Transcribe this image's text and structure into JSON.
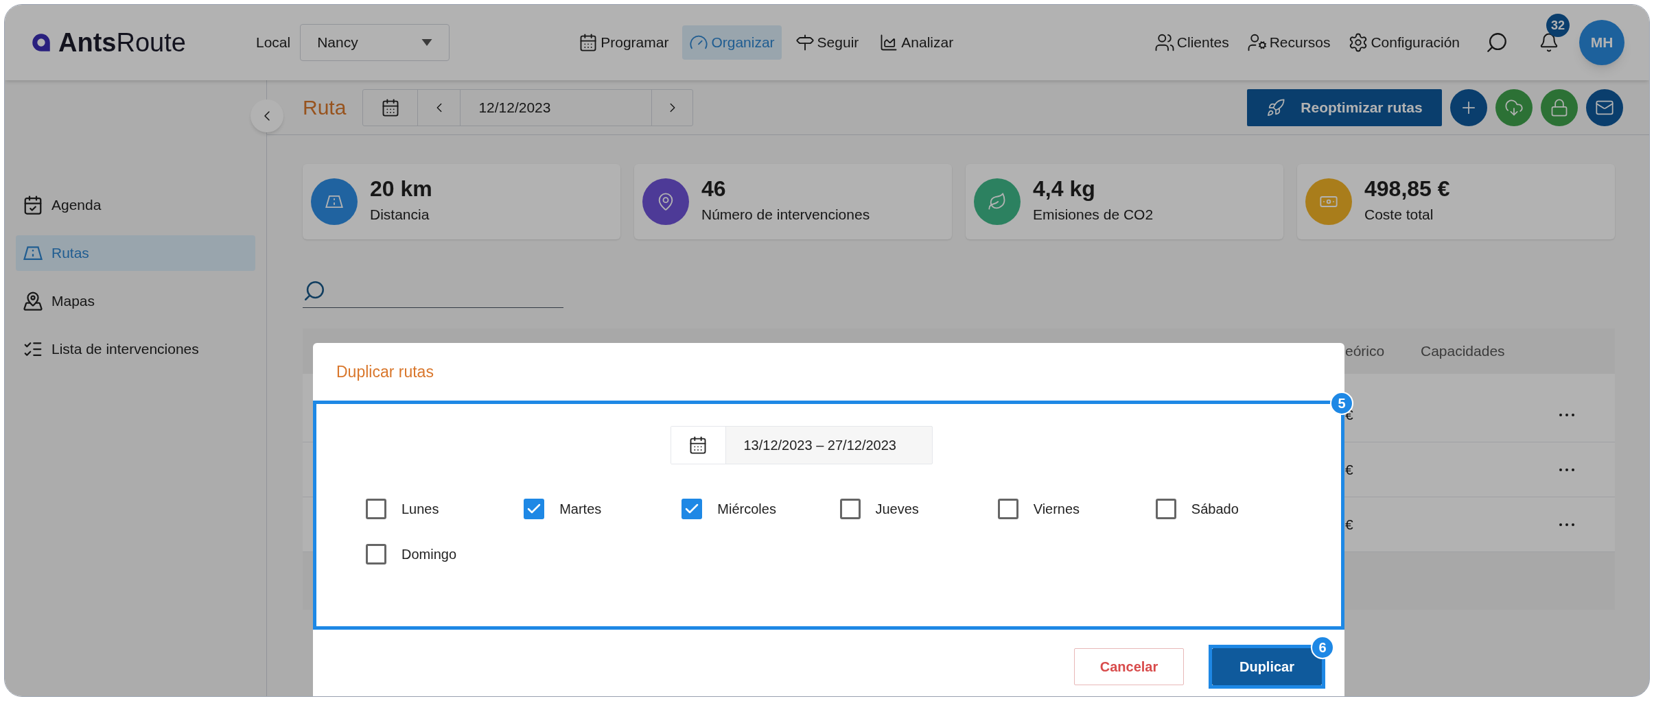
{
  "header": {
    "logo": {
      "brand_bold": "Ants",
      "brand_light": "Route"
    },
    "location": {
      "label": "Local",
      "value": "Nancy"
    },
    "nav": [
      {
        "label": "Programar",
        "selected": false,
        "kind": "calendar"
      },
      {
        "label": "Organizar",
        "selected": true,
        "kind": "gauge"
      },
      {
        "label": "Seguir",
        "selected": false,
        "kind": "signpost"
      },
      {
        "label": "Analizar",
        "selected": false,
        "kind": "chart"
      }
    ],
    "tools": [
      {
        "label": "Clientes",
        "kind": "clients"
      },
      {
        "label": "Recursos",
        "kind": "resources"
      },
      {
        "label": "Configuración",
        "kind": "settings"
      }
    ],
    "notifications": {
      "count": "32"
    },
    "avatar": {
      "initials": "MH"
    }
  },
  "sidebar": {
    "items": [
      {
        "label": "Agenda",
        "selected": false,
        "kind": "agenda"
      },
      {
        "label": "Rutas",
        "selected": true,
        "kind": "routes"
      },
      {
        "label": "Mapas",
        "selected": false,
        "kind": "maps"
      },
      {
        "label": "Lista de intervenciones",
        "selected": false,
        "kind": "list"
      }
    ]
  },
  "toolbar": {
    "title": "Ruta",
    "date": "12/12/2023",
    "primary_action": "Reoptimizar rutas",
    "actions": [
      {
        "kind": "add"
      },
      {
        "kind": "download"
      },
      {
        "kind": "lock"
      },
      {
        "kind": "mail"
      }
    ]
  },
  "stats": [
    {
      "value": "20 km",
      "label": "Distancia",
      "kind": "distance"
    },
    {
      "value": "46",
      "label": "Número de intervenciones",
      "kind": "interventions"
    },
    {
      "value": "4,4 kg",
      "label": "Emisiones de CO2",
      "kind": "emissions"
    },
    {
      "value": "498,85 €",
      "label": "Coste total",
      "kind": "cost"
    }
  ],
  "table": {
    "columns": [
      "eórico",
      "Capacidades"
    ],
    "rows": [
      {
        "cell": "€"
      },
      {
        "cell": "€"
      },
      {
        "cell": "€"
      }
    ]
  },
  "dialog": {
    "title": "Duplicar rutas",
    "date_range": "13/12/2023 – 27/12/2023",
    "days": [
      {
        "label": "Lunes",
        "checked": false
      },
      {
        "label": "Martes",
        "checked": true
      },
      {
        "label": "Miércoles",
        "checked": true
      },
      {
        "label": "Jueves",
        "checked": false
      },
      {
        "label": "Viernes",
        "checked": false
      },
      {
        "label": "Sábado",
        "checked": false
      },
      {
        "label": "Domingo",
        "checked": false
      }
    ],
    "buttons": [
      {
        "label": "Cancelar",
        "kind": "secondary"
      },
      {
        "label": "Duplicar",
        "kind": "primary"
      }
    ]
  },
  "annotations": [
    {
      "label": "5"
    },
    {
      "label": "6"
    }
  ]
}
